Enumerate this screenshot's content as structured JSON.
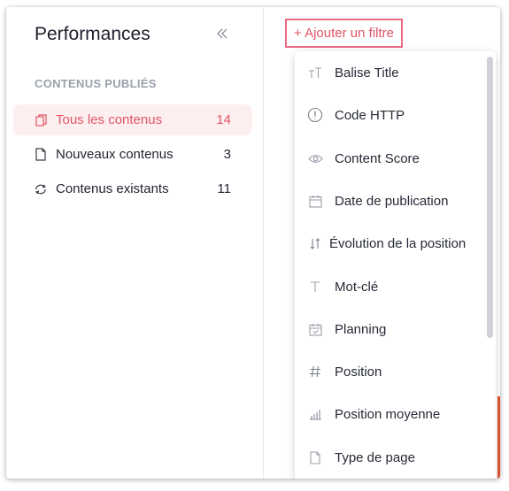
{
  "sidebar": {
    "title": "Performances",
    "collapse_icon": "double-chevron-left-icon",
    "section_title": "CONTENUS PUBLIÉS",
    "items": [
      {
        "label": "Tous les contenus",
        "count": "14",
        "icon": "copy-icon",
        "active": true
      },
      {
        "label": "Nouveaux contenus",
        "count": "3",
        "icon": "file-icon",
        "active": false
      },
      {
        "label": "Contenus existants",
        "count": "11",
        "icon": "refresh-icon",
        "active": false
      }
    ]
  },
  "main": {
    "add_filter_label": "+ Ajouter un filtre",
    "filter_options": [
      {
        "label": "Balise Title",
        "icon": "title-tag-icon"
      },
      {
        "label": "Code HTTP",
        "icon": "info-circle-icon"
      },
      {
        "label": "Content Score",
        "icon": "eye-icon"
      },
      {
        "label": "Date de publication",
        "icon": "calendar-icon"
      },
      {
        "label": "Évolution de la position",
        "icon": "arrows-updown-icon"
      },
      {
        "label": "Mot-clé",
        "icon": "text-icon"
      },
      {
        "label": "Planning",
        "icon": "calendar-check-icon"
      },
      {
        "label": "Position",
        "icon": "hash-icon"
      },
      {
        "label": "Position moyenne",
        "icon": "bar-chart-icon"
      },
      {
        "label": "Type de page",
        "icon": "page-icon"
      }
    ]
  },
  "colors": {
    "accent": "#e05565",
    "active_bg": "#fdeff0",
    "filter_border": "#e96a86"
  }
}
